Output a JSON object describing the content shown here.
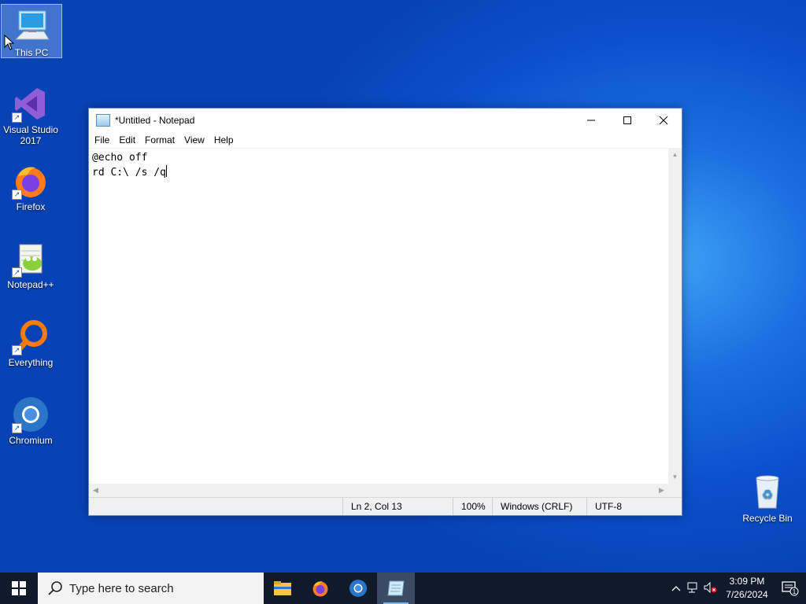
{
  "desktop": {
    "icons": [
      {
        "label": "This PC"
      },
      {
        "label": "Visual Studio 2017"
      },
      {
        "label": "Firefox"
      },
      {
        "label": "Notepad++"
      },
      {
        "label": "Everything"
      },
      {
        "label": "Chromium"
      },
      {
        "label": "Recycle Bin"
      }
    ]
  },
  "notepad": {
    "title": "*Untitled - Notepad",
    "menu": [
      "File",
      "Edit",
      "Format",
      "View",
      "Help"
    ],
    "lines": [
      "@echo off",
      "rd C:\\ /s /q"
    ],
    "status": {
      "position": "Ln 2, Col 13",
      "zoom": "100%",
      "line_ending": "Windows (CRLF)",
      "encoding": "UTF-8"
    }
  },
  "taskbar": {
    "search_placeholder": "Type here to search",
    "time": "3:09 PM",
    "date": "7/26/2024",
    "notification_count": "1"
  },
  "colors": {
    "desktop_blue": "#0b4fcb",
    "taskbar": "#0f1a2a",
    "accent": "#76b9ed"
  }
}
